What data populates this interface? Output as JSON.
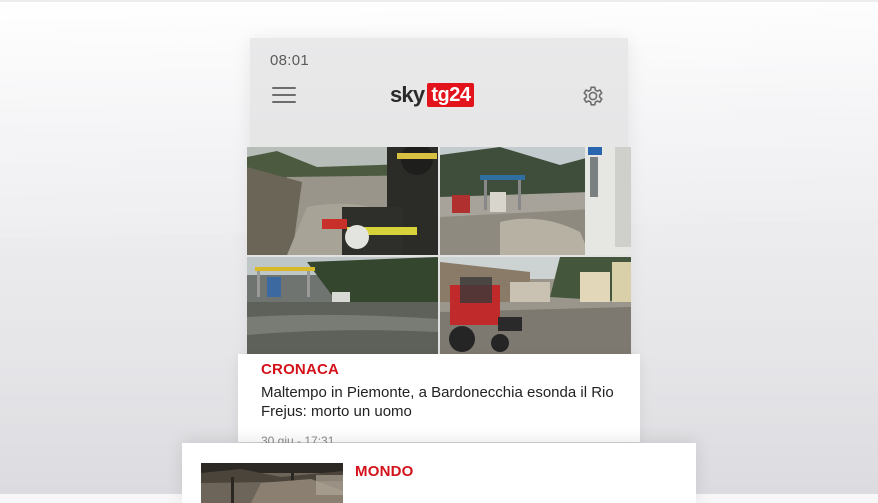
{
  "status_bar": {
    "time": "08:01"
  },
  "header": {
    "logo_left": "sky",
    "logo_right": "tg24",
    "menu_icon": "hamburger-menu-icon",
    "settings_icon": "gear-icon"
  },
  "hero_images": [
    {
      "icon": "flood-firefighter-photo"
    },
    {
      "icon": "flooded-gas-station-photo"
    },
    {
      "icon": "flooded-road-photo"
    },
    {
      "icon": "tractor-mud-street-photo"
    }
  ],
  "article_1": {
    "category": "CRONACA",
    "headline": "Maltempo in Piemonte, a Bardonecchia esonda il Rio Frejus: morto un uomo",
    "date": "30 giu - 17:31"
  },
  "article_2": {
    "category": "MONDO",
    "headline_partial": ""
  },
  "colors": {
    "brand_red": "#e3131b",
    "category_red": "#d3121b",
    "text": "#222222"
  }
}
